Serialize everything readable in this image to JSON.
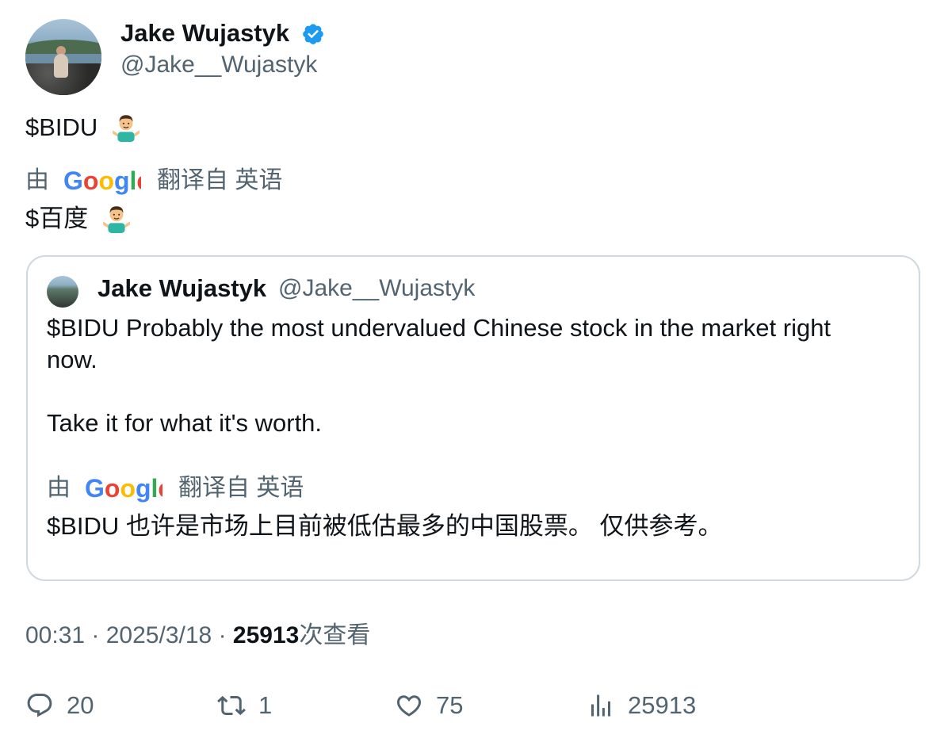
{
  "author": {
    "name": "Jake Wujastyk",
    "handle": "@Jake__Wujastyk",
    "verified": true
  },
  "tweet": {
    "text": "$BIDU",
    "emoji": "person-shrugging",
    "translation": {
      "prefix": "由",
      "provider": "Google",
      "suffix": "翻译自 英语",
      "text": "$百度"
    }
  },
  "quoted_tweet": {
    "name": "Jake Wujastyk",
    "handle": "@Jake__Wujastyk",
    "text": "$BIDU Probably the most undervalued Chinese stock in the market right now.\n\nTake it for what it's worth.",
    "translation": {
      "prefix": "由",
      "provider": "Google",
      "suffix": "翻译自 英语",
      "text": "$BIDU 也许是市场上目前被低估最多的中国股票。 仅供参考。"
    }
  },
  "meta": {
    "time": "00:31",
    "date": "2025/3/18",
    "views": "25913",
    "views_label": "次查看"
  },
  "actions": {
    "replies": "20",
    "retweets": "1",
    "likes": "75",
    "views": "25913"
  },
  "colors": {
    "verified": "#1d9bf0",
    "secondary_text": "#536471",
    "border": "#cfd9de"
  }
}
